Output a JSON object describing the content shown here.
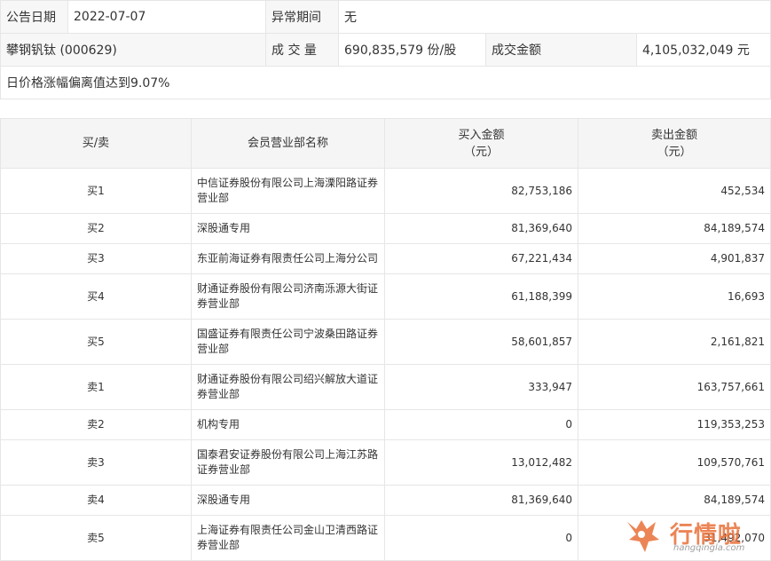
{
  "info": {
    "date_label": "公告日期",
    "date_value": "2022-07-07",
    "anomaly_label": "异常期间",
    "anomaly_value": "无",
    "stock_name": "攀钢钒钛 (000629)",
    "volume_label": "成 交 量",
    "volume_value": "690,835,579 份/股",
    "amount_label": "成交金额",
    "amount_value": "4,105,032,049 元",
    "reason": "日价格涨幅偏离值达到9.07%"
  },
  "table": {
    "headers": {
      "side": "买/卖",
      "name": "会员营业部名称",
      "buy_line1": "买入金额",
      "buy_line2": "（元）",
      "sell_line1": "卖出金额",
      "sell_line2": "（元）"
    },
    "rows": [
      {
        "side": "买1",
        "name": "中信证券股份有限公司上海溧阳路证券营业部",
        "buy": "82,753,186",
        "sell": "452,534"
      },
      {
        "side": "买2",
        "name": "深股通专用",
        "buy": "81,369,640",
        "sell": "84,189,574"
      },
      {
        "side": "买3",
        "name": "东亚前海证券有限责任公司上海分公司",
        "buy": "67,221,434",
        "sell": "4,901,837"
      },
      {
        "side": "买4",
        "name": "财通证券股份有限公司济南泺源大街证券营业部",
        "buy": "61,188,399",
        "sell": "16,693"
      },
      {
        "side": "买5",
        "name": "国盛证券有限责任公司宁波桑田路证券营业部",
        "buy": "58,601,857",
        "sell": "2,161,821"
      },
      {
        "side": "卖1",
        "name": "财通证券股份有限公司绍兴解放大道证券营业部",
        "buy": "333,947",
        "sell": "163,757,661"
      },
      {
        "side": "卖2",
        "name": "机构专用",
        "buy": "0",
        "sell": "119,353,253"
      },
      {
        "side": "卖3",
        "name": "国泰君安证券股份有限公司上海江苏路证券营业部",
        "buy": "13,012,482",
        "sell": "109,570,761"
      },
      {
        "side": "卖4",
        "name": "深股通专用",
        "buy": "81,369,640",
        "sell": "84,189,574"
      },
      {
        "side": "卖5",
        "name": "上海证券有限责任公司金山卫清西路证券营业部",
        "buy": "0",
        "sell": "31,492,070"
      }
    ]
  },
  "watermark": {
    "text": "行情啦",
    "sub": "hangqingla.com",
    "icon": "bull-logo-icon",
    "color": "#e97038"
  }
}
